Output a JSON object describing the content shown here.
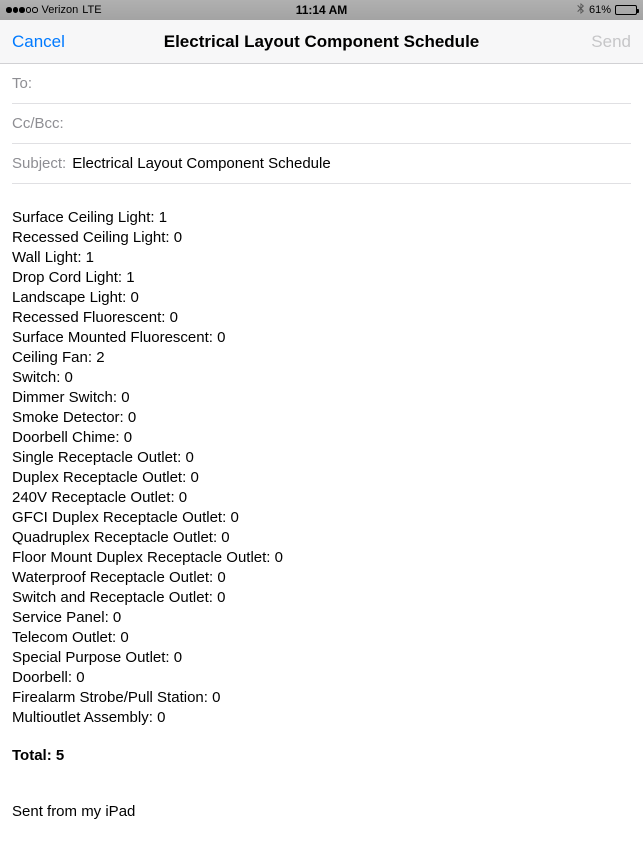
{
  "status": {
    "carrier": "Verizon",
    "network": "LTE",
    "time": "11:14 AM",
    "battery_pct": "61%",
    "battery_fill_pct": 61
  },
  "nav": {
    "cancel": "Cancel",
    "title": "Electrical Layout Component Schedule",
    "send": "Send"
  },
  "fields": {
    "to_label": "To:",
    "to_value": "",
    "cc_label": "Cc/Bcc:",
    "cc_value": "",
    "subject_label": "Subject:",
    "subject_value": "Electrical Layout Component Schedule"
  },
  "body": {
    "items": [
      {
        "name": "Surface Ceiling Light",
        "count": 1
      },
      {
        "name": "Recessed Ceiling Light",
        "count": 0
      },
      {
        "name": "Wall Light",
        "count": 1
      },
      {
        "name": "Drop Cord Light",
        "count": 1
      },
      {
        "name": "Landscape Light",
        "count": 0
      },
      {
        "name": "Recessed Fluorescent",
        "count": 0
      },
      {
        "name": "Surface Mounted Fluorescent",
        "count": 0
      },
      {
        "name": "Ceiling Fan",
        "count": 2
      },
      {
        "name": "Switch",
        "count": 0
      },
      {
        "name": "Dimmer Switch",
        "count": 0
      },
      {
        "name": "Smoke Detector",
        "count": 0
      },
      {
        "name": "Doorbell Chime",
        "count": 0
      },
      {
        "name": "Single Receptacle Outlet",
        "count": 0
      },
      {
        "name": "Duplex Receptacle Outlet",
        "count": 0
      },
      {
        "name": "240V Receptacle Outlet",
        "count": 0
      },
      {
        "name": "GFCI Duplex Receptacle Outlet",
        "count": 0
      },
      {
        "name": "Quadruplex Receptacle Outlet",
        "count": 0
      },
      {
        "name": "Floor Mount Duplex Receptacle Outlet",
        "count": 0
      },
      {
        "name": "Waterproof Receptacle Outlet",
        "count": 0
      },
      {
        "name": "Switch and Receptacle Outlet",
        "count": 0
      },
      {
        "name": "Service Panel",
        "count": 0
      },
      {
        "name": "Telecom Outlet",
        "count": 0
      },
      {
        "name": "Special Purpose Outlet",
        "count": 0
      },
      {
        "name": "Doorbell",
        "count": 0
      },
      {
        "name": "Firealarm Strobe/Pull Station",
        "count": 0
      },
      {
        "name": "Multioutlet Assembly",
        "count": 0
      }
    ],
    "total_label": "Total:",
    "total_value": 5,
    "signature": "Sent from my iPad"
  }
}
